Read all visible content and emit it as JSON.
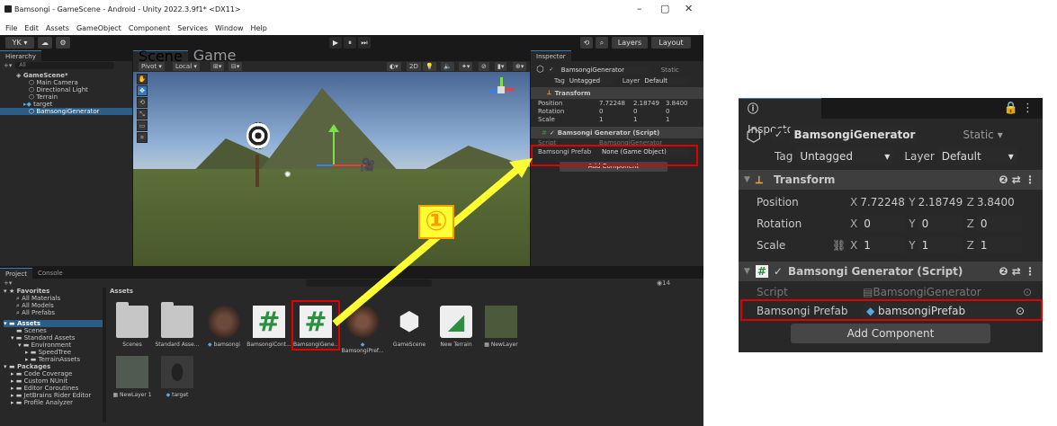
{
  "window": {
    "title": "Bamsongi - GameScene - Android - Unity 2022.3.9f1* <DX11>",
    "minimize": "–",
    "maximize": "▢",
    "close": "✕"
  },
  "menu": [
    "File",
    "Edit",
    "Assets",
    "GameObject",
    "Component",
    "Services",
    "Window",
    "Help"
  ],
  "toolbar": {
    "account": "YK ▾",
    "cloud": "☁",
    "play": "▶",
    "pause": "⏸",
    "step": "⏭",
    "history": "⟲",
    "search": "🔍",
    "layers": "Layers",
    "layout": "Layout"
  },
  "hierarchy": {
    "tab": "Hierarchy",
    "search_placeholder": "All",
    "items": [
      {
        "label": "GameScene*",
        "selected": false
      },
      {
        "label": "Main Camera",
        "selected": false
      },
      {
        "label": "Directional Light",
        "selected": false
      },
      {
        "label": "Terrain",
        "selected": false
      },
      {
        "label": "target",
        "selected": false
      },
      {
        "label": "BamsongiGenerator",
        "selected": true
      }
    ]
  },
  "scene": {
    "tab_scene": "Scene",
    "tab_game": "Game",
    "pivot": "Pivot ▾",
    "local": "Local ▾",
    "mode_2d": "2D",
    "tools": [
      "✋",
      "✥",
      "⟲",
      "⤡",
      "▭",
      "⌗"
    ]
  },
  "inspector_small": {
    "tab": "Inspector",
    "object_name": "BamsongiGenerator",
    "static": "Static",
    "tag_label": "Tag",
    "tag_value": "Untagged",
    "layer_label": "Layer",
    "layer_value": "Default",
    "transform": "Transform",
    "position_label": "Position",
    "rotation_label": "Rotation",
    "scale_label": "Scale",
    "pos": [
      "7.72248",
      "2.18749",
      "3.8400"
    ],
    "rot": [
      "0",
      "0",
      "0"
    ],
    "scl": [
      "1",
      "1",
      "1"
    ],
    "script_component": "Bamsongi Generator (Script)",
    "script_label": "Script",
    "script_value": "BamsongiGenerator",
    "prefab_label": "Bamsongi Prefab",
    "prefab_value": "None (Game Object)",
    "add_component": "Add Component"
  },
  "project": {
    "tab_project": "Project",
    "tab_console": "Console",
    "assets_header": "Assets",
    "hidden_count": "14",
    "tree": [
      "Favorites",
      "All Materials",
      "All Models",
      "All Prefabs",
      "Assets",
      "Scenes",
      "Standard Assets",
      "Environment",
      "SpeedTree",
      "TerrainAssets",
      "Packages",
      "Code Coverage",
      "Custom NUnit",
      "Editor Coroutines",
      "JetBrains Rider Editor",
      "Profile Analyzer"
    ],
    "assets": [
      "Scenes",
      "Standard Asse...",
      "bamsongi",
      "BamsongiCont...",
      "BamsongiGene...",
      "BamsongiPref...",
      "GameScene",
      "New Terrain",
      "NewLayer",
      "NewLayer 1",
      "target"
    ]
  },
  "annotation": {
    "step": "①"
  },
  "inspector_zoom": {
    "tab": "Inspector",
    "object_name": "BamsongiGenerator",
    "static": "Static",
    "tag_label": "Tag",
    "tag_value": "Untagged",
    "layer_label": "Layer",
    "layer_value": "Default",
    "transform": "Transform",
    "position_label": "Position",
    "rotation_label": "Rotation",
    "scale_label": "Scale",
    "pos": [
      "7.72248",
      "2.18749",
      "3.8400"
    ],
    "rot": [
      "0",
      "0",
      "0"
    ],
    "scl": [
      "1",
      "1",
      "1"
    ],
    "axes": [
      "X",
      "Y",
      "Z"
    ],
    "script_component": "Bamsongi Generator (Script)",
    "script_label": "Script",
    "script_value": "BamsongiGenerator",
    "prefab_label": "Bamsongi Prefab",
    "prefab_value": "bamsongiPrefab",
    "add_component": "Add Component"
  },
  "colors": {
    "highlight_red": "#e00000",
    "arrow_yellow": "#ffff33",
    "badge_orange": "#ff9900",
    "selection_blue": "#2c5d87",
    "script_green": "#2a8f3e"
  }
}
